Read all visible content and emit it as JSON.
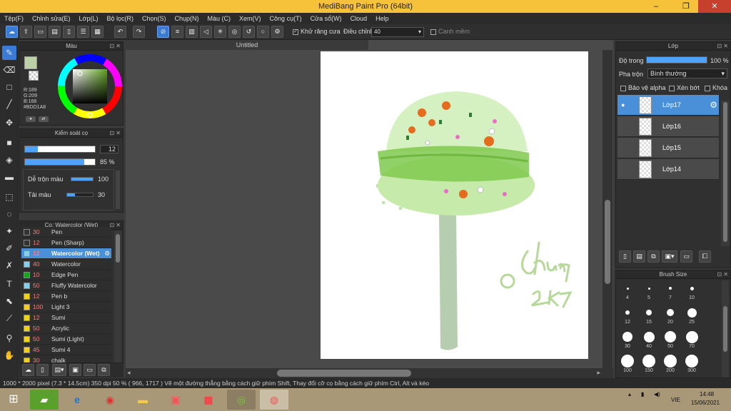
{
  "window": {
    "title": "MediBang Paint Pro (64bit)",
    "minimize": "–",
    "restore": "❐",
    "close": "✕"
  },
  "menu": [
    "Tệp(F)",
    "Chỉnh sửa(E)",
    "Lớp(L)",
    "Bộ lọc(R)",
    "Chọn(S)",
    "Chụp(N)",
    "Màu (C)",
    "Xem(V)",
    "Công cụ(T)",
    "Cửa sổ(W)",
    "Cloud",
    "Help"
  ],
  "toolbar": {
    "antialias_label": "Khử răng cưa",
    "antialias_checked": true,
    "adjust_label": "Điều chỉnh",
    "adjust_value": "40",
    "smooth_edge_label": "Canh mềm",
    "smooth_edge_checked": false
  },
  "color_panel": {
    "title": "Màu",
    "r": "R:189",
    "g": "G:209",
    "b": "B:168",
    "hex": "#BDD1A8",
    "fg_color": "#BDD1A8",
    "bg_color": "#FFFFFF"
  },
  "brush_control": {
    "title": "Kiểm soát cọ",
    "size_value": "12",
    "size_fraction": 0.18,
    "opacity_value": "85 %",
    "opacity_fraction": 0.85,
    "blend_label": "Dễ trộn màu",
    "blend_value": "100",
    "blend_fraction": 1.0,
    "reload_label": "Tải màu",
    "reload_value": "30",
    "reload_fraction": 0.3
  },
  "brush_panel": {
    "title": "Cọ: Watercolor (Wet)",
    "brushes": [
      {
        "size": "30",
        "name": "Pen",
        "color": "#333333",
        "selected": false
      },
      {
        "size": "12",
        "name": "Pen (Sharp)",
        "color": "#333333",
        "selected": false
      },
      {
        "size": "12",
        "name": "Watercolor (Wet)",
        "color": "#87ceeb",
        "selected": true
      },
      {
        "size": "40",
        "name": "Watercolor",
        "color": "#87ceeb",
        "selected": false
      },
      {
        "size": "10",
        "name": "Edge Pen",
        "color": "#1fa31f",
        "selected": false
      },
      {
        "size": "50",
        "name": "Fluffy Watercolor",
        "color": "#87ceeb",
        "selected": false
      },
      {
        "size": "12",
        "name": " Pen b",
        "color": "#f0d020",
        "selected": false
      },
      {
        "size": "100",
        "name": "Light 3",
        "color": "#f0d020",
        "selected": false
      },
      {
        "size": "12",
        "name": "Sumi",
        "color": "#f0d020",
        "selected": false
      },
      {
        "size": "50",
        "name": "Acrylic",
        "color": "#f0d020",
        "selected": false
      },
      {
        "size": "50",
        "name": "Sumi (Light)",
        "color": "#f0d020",
        "selected": false
      },
      {
        "size": "45",
        "name": "Sumi 4",
        "color": "#f0d020",
        "selected": false
      },
      {
        "size": "30",
        "name": "chalk",
        "color": "#f0d020",
        "selected": false
      }
    ]
  },
  "canvas": {
    "tab_title": "Untitled",
    "signature": "@chung 2K7"
  },
  "layer_panel": {
    "title": "Lớp",
    "opacity_label": "Độ trong",
    "opacity_value": "100 %",
    "opacity_fraction": 1.0,
    "blend_label": "Pha trộn",
    "blend_value": "Bình thường",
    "protect_alpha": "Bảo vệ alpha",
    "clipping": "Xén bớt",
    "lock": "Khóa",
    "layers": [
      {
        "name": "Lớp17",
        "selected": true
      },
      {
        "name": "Lớp16",
        "selected": false
      },
      {
        "name": "Lớp15",
        "selected": false
      },
      {
        "name": "Lớp14",
        "selected": false
      }
    ]
  },
  "brush_size_panel": {
    "title": "Brush Size",
    "sizes": [
      "4",
      "5",
      "7",
      "10",
      "12",
      "15",
      "20",
      "25",
      "30",
      "40",
      "50",
      "70",
      "100",
      "150",
      "200",
      "300"
    ]
  },
  "status": {
    "text": "1000 * 2000 pixel   (7.3 * 14.5cm)   350 dpi   50 %    ( 966, 1717 )  Vẽ một đường thẳng bằng cách giữ phím Shift, Thay đổi cỡ cọ bằng cách giữ phím Ctrl, Alt và kéo"
  },
  "taskbar": {
    "lang": "VIE",
    "time": "14:48",
    "date": "15/06/2021"
  }
}
